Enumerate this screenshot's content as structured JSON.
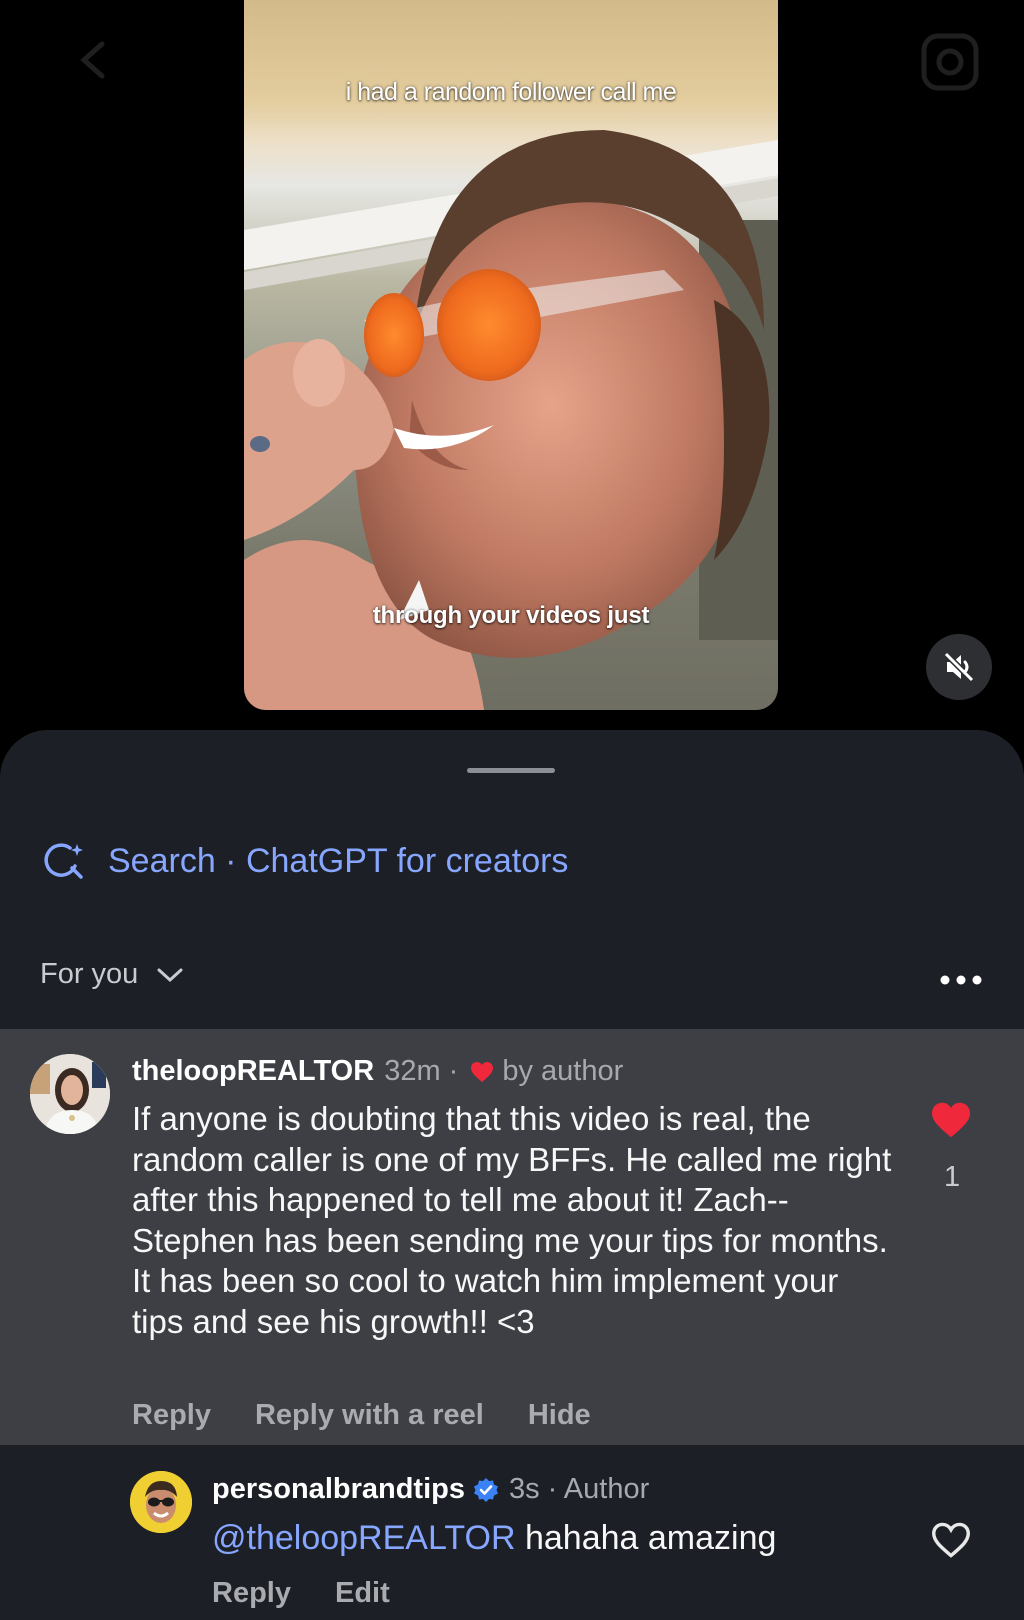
{
  "video": {
    "caption_top": "i had a random follower call me",
    "caption_bottom": "through your videos just"
  },
  "search": {
    "icon": "ai-search-sparkle-icon",
    "text": "Search · ChatGPT for creators"
  },
  "filter": {
    "label": "For you",
    "icon": "chevron-down-icon"
  },
  "comments": [
    {
      "username": "theloopREALTOR",
      "time": "32m ·",
      "liked_by_author_label": "by author",
      "text": "If anyone is doubting that this video is real, the random caller is one of my BFFs.  He called me right after this happened to tell me about it!  Zach--Stephen has been sending me your tips for months.  It has been so cool to watch him implement your tips and see his growth!! <3",
      "like_count": "1",
      "actions": [
        "Reply",
        "Reply with a reel",
        "Hide"
      ]
    }
  ],
  "reply": {
    "username": "personalbrandtips",
    "time_author": "3s · Author",
    "mention": "@theloopREALTOR",
    "text": "hahaha amazing",
    "actions": [
      "Reply",
      "Edit"
    ]
  },
  "colors": {
    "accent_blue": "#87a6ff",
    "like_red": "#f0283c",
    "sheet_bg": "#1c1f25",
    "highlight_bg": "#3d3f44"
  }
}
